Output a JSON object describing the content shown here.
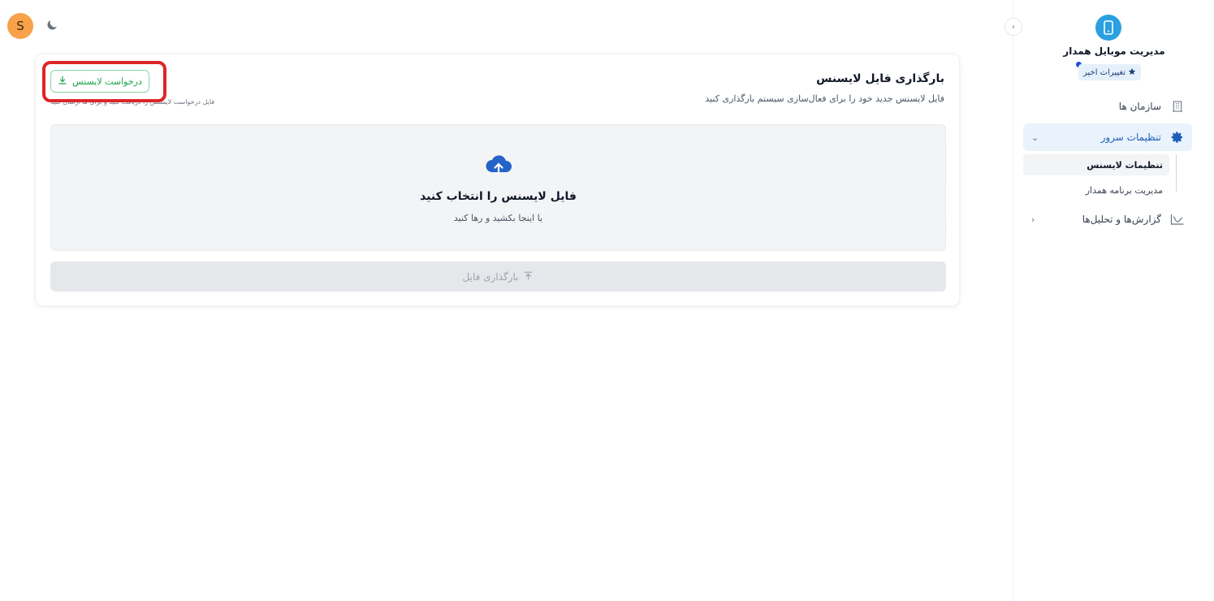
{
  "topbar": {
    "avatar_letter": "S",
    "theme_icon": "moon-icon"
  },
  "sidebar": {
    "brand_title": "مدیریت موبایل همدار",
    "recent_badge": "تغییرات اخیر",
    "items": [
      {
        "label": "سازمان ها",
        "icon": "building-icon"
      },
      {
        "label": "تنظیمات سرور",
        "icon": "gear-icon"
      },
      {
        "label": "گزارش‌ها و تحلیل‌ها",
        "icon": "chart-icon"
      }
    ],
    "sub_items": [
      {
        "label": "تنظیمات لایسنس"
      },
      {
        "label": "مدیریت برنامه همدار"
      }
    ]
  },
  "card": {
    "title": "بارگذاری فایل لایسنس",
    "subtitle": "فایل لایسنس جدید خود را برای فعال‌سازی سیستم بارگذاری کنید",
    "request_button": "درخواست لایسنس",
    "request_note": "فایل درخواست لایسنس را دریافت کنید و برای ما ارسال کنید",
    "dropzone": {
      "title": "فایل لایسنس را انتخاب کنید",
      "subtitle": "یا اینجا بکشید و رها کنید"
    },
    "upload_button": "بارگذاری فایل"
  },
  "colors": {
    "accent": "#1d5fb8",
    "success": "#16a34a",
    "highlight": "#dc2626",
    "avatar": "#f7a24a"
  }
}
